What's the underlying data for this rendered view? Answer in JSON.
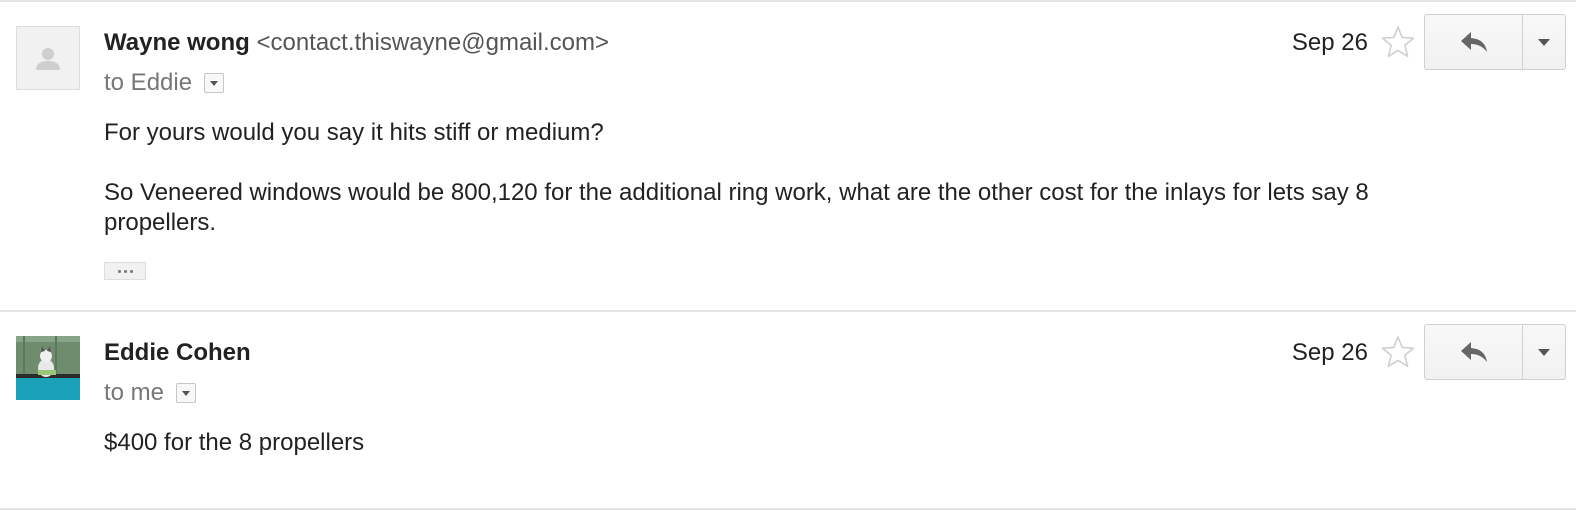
{
  "messages": [
    {
      "sender_name": "Wayne wong",
      "sender_email": "<contact.thiswayne@gmail.com>",
      "recipient": "to Eddie",
      "date": "Sep 26",
      "body": [
        "For yours would you say it hits stiff or medium?",
        "So Veneered windows would be 800,120 for the additional ring work, what are the other cost for the inlays for lets say 8 propellers."
      ],
      "has_trimmed_content": true,
      "avatar": "default-avatar"
    },
    {
      "sender_name": "Eddie Cohen",
      "recipient": "to me",
      "date": "Sep 26",
      "body": [
        "$400 for the 8 propellers"
      ],
      "avatar": "photo-avatar"
    }
  ],
  "icons": {
    "star": "star-icon",
    "reply": "reply-icon",
    "more": "chevron-down-icon",
    "recipient_details": "dropdown-icon",
    "trimmed": "ellipsis-icon"
  },
  "colors": {
    "divider": "#e5e5e5",
    "sender": "#222222",
    "secondary": "#777777"
  }
}
